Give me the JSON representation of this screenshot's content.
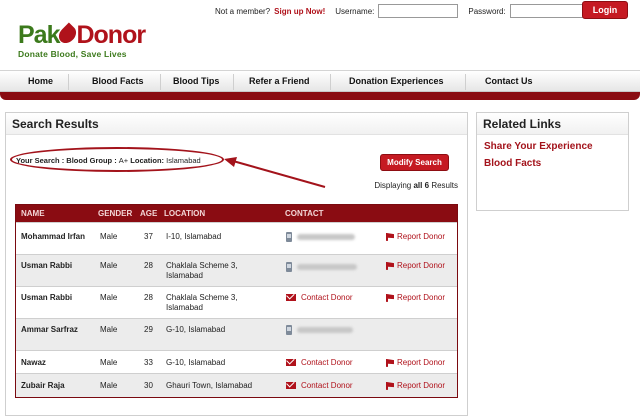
{
  "brand": {
    "logo_part1": "Pak",
    "logo_part2": "Donor",
    "tagline": "Donate Blood, Save Lives"
  },
  "login": {
    "not_member": "Not a member?",
    "signup_link": "Sign up Now!",
    "username_label": "Username:",
    "username_value": "",
    "password_label": "Password:",
    "password_value": "",
    "login_button": "Login"
  },
  "nav": {
    "items": [
      "Home",
      "Blood Facts",
      "Blood Tips",
      "Refer a Friend",
      "Donation Experiences",
      "Contact Us"
    ]
  },
  "search_results": {
    "title": "Search Results",
    "your_search_label": "Your Search : Blood Group :",
    "blood_group": "A+",
    "location_label": "Location:",
    "location_value": "Islamabad",
    "modify_button": "Modify Search",
    "displaying_prefix": "Displaying",
    "displaying_all": "all",
    "displaying_count": "6",
    "displaying_suffix": "Results"
  },
  "table": {
    "headers": [
      "NAME",
      "GENDER",
      "AGE",
      "LOCATION",
      "CONTACT"
    ],
    "rows": [
      {
        "name": "Mohammad Irfan",
        "gender": "Male",
        "age": "37",
        "location": "I-10, Islamabad",
        "contact_type": "phone",
        "contact_text": "",
        "report": "Report Donor"
      },
      {
        "name": "Usman Rabbi",
        "gender": "Male",
        "age": "28",
        "location": "Chaklala Scheme 3, Islamabad",
        "contact_type": "phone",
        "contact_text": "",
        "report": "Report Donor"
      },
      {
        "name": "Usman Rabbi",
        "gender": "Male",
        "age": "28",
        "location": "Chaklala Scheme 3, Islamabad",
        "contact_type": "email",
        "contact_text": "Contact Donor",
        "report": "Report Donor"
      },
      {
        "name": "Ammar Sarfraz",
        "gender": "Male",
        "age": "29",
        "location": "G-10, Islamabad",
        "contact_type": "phone",
        "contact_text": "",
        "report": "Report Donor"
      },
      {
        "name": "Nawaz",
        "gender": "Male",
        "age": "33",
        "location": "G-10, Islamabad",
        "contact_type": "email",
        "contact_text": "Contact Donor",
        "report": "Report Donor"
      },
      {
        "name": "Zubair Raja",
        "gender": "Male",
        "age": "30",
        "location": "Ghauri Town, Islamabad",
        "contact_type": "email",
        "contact_text": "Contact Donor",
        "report": "Report Donor"
      }
    ]
  },
  "related_links": {
    "title": "Related Links",
    "links": [
      "Share Your Experience",
      "Blood Facts"
    ]
  },
  "colors": {
    "brand_red": "#b0121b",
    "brand_green": "#3c7a1c",
    "table_header": "#8a0c12"
  }
}
